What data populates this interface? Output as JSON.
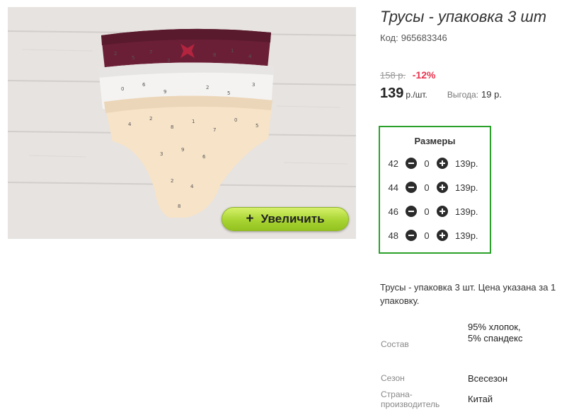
{
  "product": {
    "title": "Трусы - упаковка 3 шт",
    "code_label": "Код:",
    "code": "965683346",
    "zoom_label": "Увеличить",
    "zoom_icon": "plus-icon"
  },
  "pricing": {
    "old_price": "158 р.",
    "discount": "-12%",
    "price": "139",
    "unit": "р./шт.",
    "benefit_label": "Выгода:",
    "benefit": "19 р."
  },
  "sizes": {
    "title": "Размеры",
    "rows": [
      {
        "size": "42",
        "qty": "0",
        "price": "139р."
      },
      {
        "size": "44",
        "qty": "0",
        "price": "139р."
      },
      {
        "size": "46",
        "qty": "0",
        "price": "139р."
      },
      {
        "size": "48",
        "qty": "0",
        "price": "139р."
      }
    ]
  },
  "description": "Трусы - упаковка 3 шт. Цена указана за 1 упаковку.",
  "properties": [
    {
      "key": "Состав",
      "value": "95% хлопок, 5% спандекс"
    },
    {
      "key": "Сезон",
      "value": "Всесезон"
    },
    {
      "key": "Страна-производитель",
      "value": "Китай"
    }
  ],
  "colors": {
    "accent_green": "#2aa12a",
    "discount_red": "#e8344e",
    "zoom_button": "#a8d432"
  }
}
